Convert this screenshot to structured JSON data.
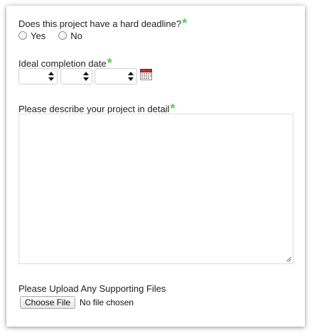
{
  "deadline": {
    "question": "Does this project have a hard deadline?",
    "required_mark": "*",
    "options": [
      "Yes",
      "No"
    ],
    "selected": null
  },
  "completion_date": {
    "label": "Ideal completion date",
    "required_mark": "*",
    "month_value": "",
    "day_value": "",
    "year_value": "",
    "calendar_icon": "calendar-icon"
  },
  "description": {
    "label": "Please describe your project in detail",
    "required_mark": "*",
    "value": ""
  },
  "upload": {
    "label": "Please Upload Any Supporting Files",
    "button_label": "Choose File",
    "status": "No file chosen"
  },
  "colors": {
    "required": "#5ec55e",
    "border": "#dcdcdc"
  }
}
